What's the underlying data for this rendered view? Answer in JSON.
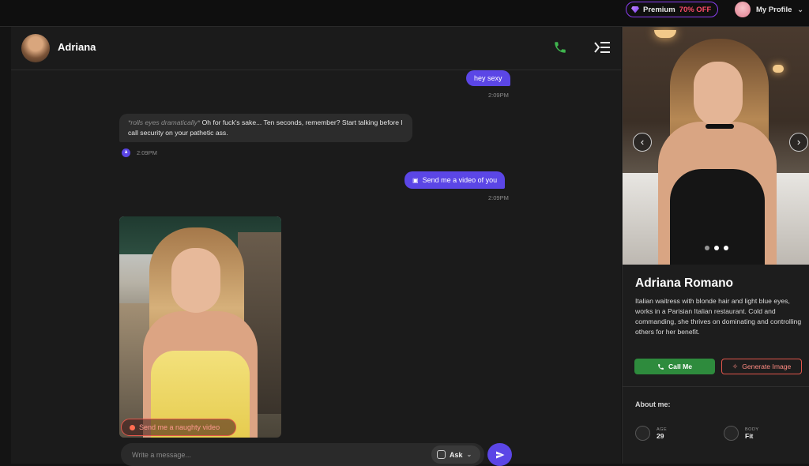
{
  "topbar": {
    "premium_label": "Premium",
    "premium_discount": "70% OFF",
    "profile_label": "My Profile"
  },
  "chat": {
    "header_name": "Adriana",
    "messages": [
      {
        "from": "user",
        "text": "hey sexy",
        "time": "2:09PM"
      },
      {
        "from": "bot",
        "action": "*rolls eyes dramatically*",
        "text": "Oh for fuck's sake... Ten seconds, remember? Start talking before I call security on your pathetic ass.",
        "time": "2:09PM"
      },
      {
        "from": "user",
        "text": "Send me a video of you",
        "time": "2:09PM"
      }
    ],
    "suggestion_label": "Send me a naughty video",
    "input_placeholder": "Write a message...",
    "ask_label": "Ask"
  },
  "profile": {
    "name": "Adriana Romano",
    "description": "Italian waitress with blonde hair and light blue eyes, works in a Parisian Italian restaurant. Cold and commanding, she thrives on dominating and controlling others for her benefit.",
    "call_label": "Call Me",
    "generate_label": "Generate Image",
    "about_title": "About me:",
    "stats": [
      {
        "label": "AGE",
        "value": "29"
      },
      {
        "label": "BODY",
        "value": "Fit"
      }
    ]
  },
  "colors": {
    "accent_purple": "#5b46e6",
    "call_green": "#2e8b3d",
    "generate_red": "#e2564b"
  }
}
